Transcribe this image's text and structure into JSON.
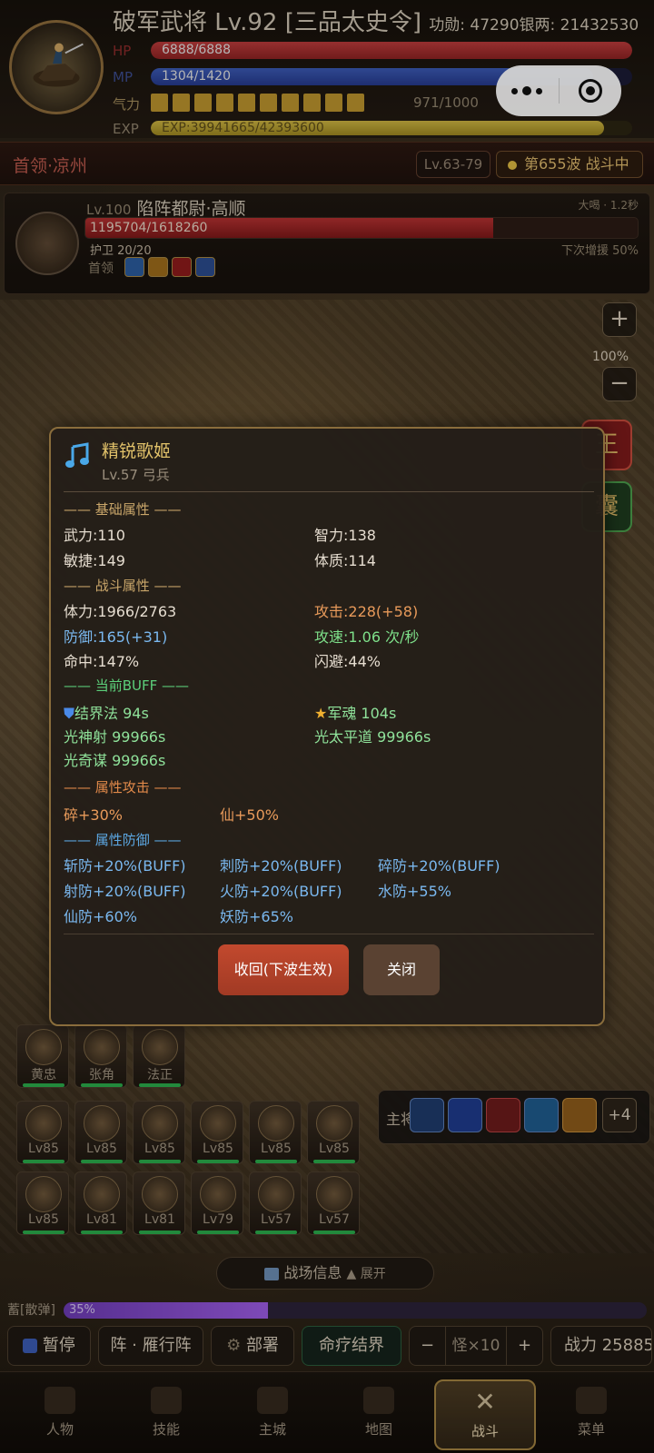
{
  "hero": {
    "title": "破军武将 Lv.92 [三品太史令]",
    "merit": "功勋: 47290银两: 21432530",
    "hp_label": "HP",
    "hp_text": "6888/6888",
    "hp_ratio": 1.0,
    "mp_label": "MP",
    "mp_text": "1304/1420",
    "mp_ratio": 0.918,
    "qi_label": "气力",
    "qi_text": "971/1000",
    "qi_blocks": 10,
    "exp_label": "EXP",
    "exp_text": "EXP:39941665/42393600",
    "exp_ratio": 0.942
  },
  "zone": {
    "name": "首领·凉州",
    "level_range": "Lv.63-79",
    "wave": "第655波 战斗中"
  },
  "boss": {
    "level": "Lv.100",
    "name": "陷阵都尉·高顺",
    "hp_text": "1195704/1618260",
    "hp_ratio": 0.739,
    "skill": "大喝 · 1.2秒",
    "guard": "护卫 20/20",
    "next": "下次增援 50%",
    "tag": "首领",
    "icons": [
      "shield-down-icon",
      "strike-icon",
      "horseshoe-icon",
      "guard-icon"
    ]
  },
  "zoom": {
    "plus": "+",
    "minus": "−",
    "level": "100%"
  },
  "side": {
    "btn1": "王",
    "btn2": "囊"
  },
  "dialog": {
    "name": "精锐歌姬",
    "sub": "Lv.57 弓兵",
    "sections": {
      "basic": "—— 基础属性 ——",
      "combat": "—— 战斗属性 ——",
      "buff": "—— 当前BUFF ——",
      "attack": "—— 属性攻击 ——",
      "defense": "—— 属性防御 ——"
    },
    "basic": {
      "str": "武力:110",
      "int": "智力:138",
      "agi": "敏捷:149",
      "con": "体质:114"
    },
    "combat": {
      "hp": "体力:1966/2763",
      "atk": "攻击:228(+58)",
      "def": "防御:165(+31)",
      "spd": "攻速:1.06 次/秒",
      "hit": "命中:147%",
      "dodge": "闪避:44%"
    },
    "buffs": {
      "b1": "结界法 94s",
      "b2": "军魂 104s",
      "b3": "光神射 99966s",
      "b4": "光太平道 99966s",
      "b5": "光奇谋 99966s"
    },
    "attack": {
      "a1": "碎+30%",
      "a2": "仙+50%"
    },
    "defense": {
      "d1": "斩防+20%(BUFF)",
      "d2": "刺防+20%(BUFF)",
      "d3": "碎防+20%(BUFF)",
      "d4": "射防+20%(BUFF)",
      "d5": "火防+20%(BUFF)",
      "d6": "水防+55%",
      "d7": "仙防+60%",
      "d8": "妖防+65%"
    },
    "recall_btn": "收回(下波生效)",
    "close_btn": "关闭"
  },
  "generals": [
    {
      "name": "黄忠"
    },
    {
      "name": "张角"
    },
    {
      "name": "法正"
    }
  ],
  "troops_row1": [
    "Lv85",
    "Lv85",
    "Lv85",
    "Lv85",
    "Lv85",
    "Lv85"
  ],
  "troops_row2": [
    "Lv85",
    "Lv81",
    "Lv81",
    "Lv79",
    "Lv57",
    "Lv57"
  ],
  "skillbar": {
    "label": "主将",
    "more": "+4"
  },
  "field": {
    "label": "战场信息",
    "expand": "▲ 展开"
  },
  "charge": {
    "label": "蓄[散弹]",
    "text": "35%",
    "ratio": 0.35
  },
  "controls": {
    "pause": "暂停",
    "formation": "阵 · 雁行阵",
    "deploy": "部署",
    "heal": "命疗结界",
    "minus": "−",
    "monster": "怪×10",
    "plus": "+",
    "power": "战力 25885"
  },
  "nav": [
    "人物",
    "技能",
    "主城",
    "地图",
    "战斗",
    "菜单"
  ]
}
